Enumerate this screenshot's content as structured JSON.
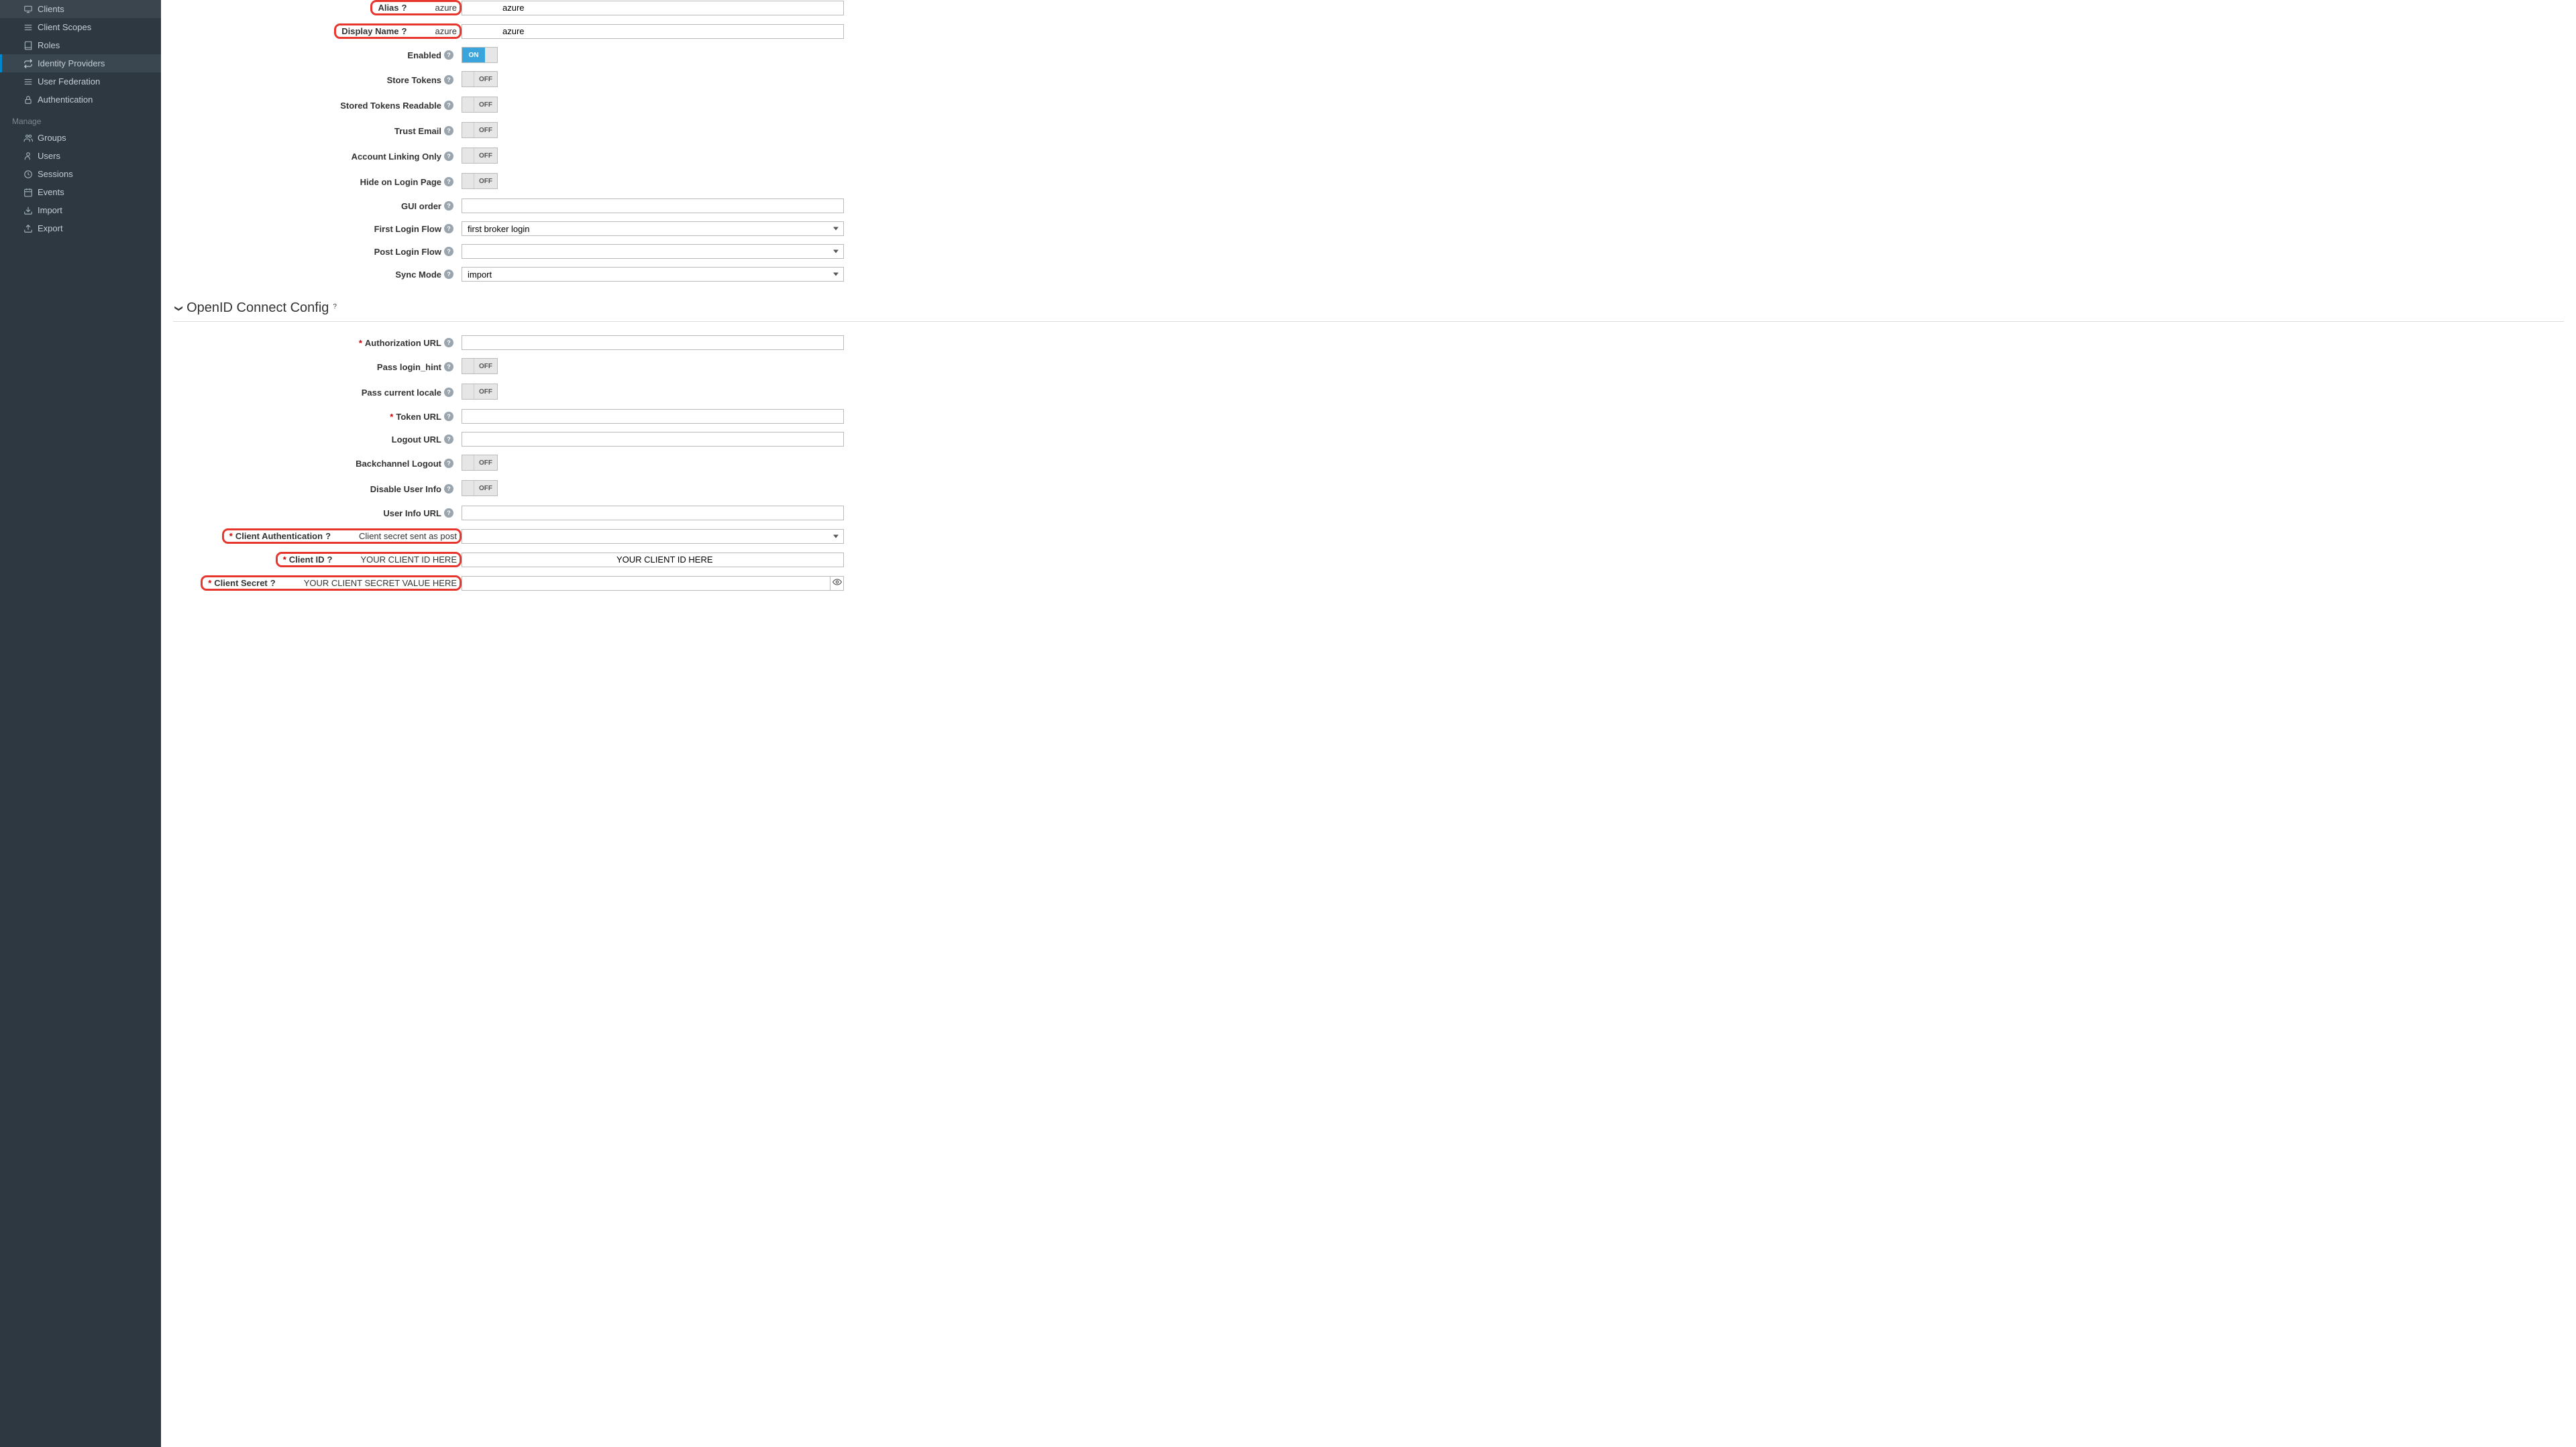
{
  "sidebar": {
    "configure_items": [
      {
        "label": "Clients",
        "icon": "clients-icon"
      },
      {
        "label": "Client Scopes",
        "icon": "client-scopes-icon"
      },
      {
        "label": "Roles",
        "icon": "roles-icon"
      },
      {
        "label": "Identity Providers",
        "icon": "identity-providers-icon",
        "active": true
      },
      {
        "label": "User Federation",
        "icon": "user-federation-icon"
      },
      {
        "label": "Authentication",
        "icon": "authentication-icon"
      }
    ],
    "manage_label": "Manage",
    "manage_items": [
      {
        "label": "Groups",
        "icon": "groups-icon"
      },
      {
        "label": "Users",
        "icon": "users-icon"
      },
      {
        "label": "Sessions",
        "icon": "sessions-icon"
      },
      {
        "label": "Events",
        "icon": "events-icon"
      },
      {
        "label": "Import",
        "icon": "import-icon"
      },
      {
        "label": "Export",
        "icon": "export-icon"
      }
    ]
  },
  "section_oidc": "OpenID Connect Config",
  "toggle": {
    "on": "ON",
    "off": "OFF"
  },
  "fields": {
    "alias": {
      "label": "Alias",
      "value": "azure"
    },
    "display_name": {
      "label": "Display Name",
      "value": "azure"
    },
    "enabled": {
      "label": "Enabled",
      "value": "ON"
    },
    "store_tokens": {
      "label": "Store Tokens",
      "value": "OFF"
    },
    "stored_tokens_readable": {
      "label": "Stored Tokens Readable",
      "value": "OFF"
    },
    "trust_email": {
      "label": "Trust Email",
      "value": "OFF"
    },
    "account_linking_only": {
      "label": "Account Linking Only",
      "value": "OFF"
    },
    "hide_on_login": {
      "label": "Hide on Login Page",
      "value": "OFF"
    },
    "gui_order": {
      "label": "GUI order",
      "value": ""
    },
    "first_login_flow": {
      "label": "First Login Flow",
      "value": "first broker login"
    },
    "post_login_flow": {
      "label": "Post Login Flow",
      "value": ""
    },
    "sync_mode": {
      "label": "Sync Mode",
      "value": "import"
    },
    "authorization_url": {
      "label": "Authorization URL",
      "value": "",
      "required": true
    },
    "pass_login_hint": {
      "label": "Pass login_hint",
      "value": "OFF"
    },
    "pass_current_locale": {
      "label": "Pass current locale",
      "value": "OFF"
    },
    "token_url": {
      "label": "Token URL",
      "value": "",
      "required": true
    },
    "logout_url": {
      "label": "Logout URL",
      "value": ""
    },
    "backchannel_logout": {
      "label": "Backchannel Logout",
      "value": "OFF"
    },
    "disable_user_info": {
      "label": "Disable User Info",
      "value": "OFF"
    },
    "user_info_url": {
      "label": "User Info URL",
      "value": ""
    },
    "client_authentication": {
      "label": "Client Authentication",
      "value": "Client secret sent as post",
      "required": true
    },
    "client_id": {
      "label": "Client ID",
      "value": "YOUR CLIENT ID HERE",
      "required": true
    },
    "client_secret": {
      "label": "Client Secret",
      "value": "YOUR CLIENT SECRET VALUE HERE",
      "required": true
    }
  }
}
